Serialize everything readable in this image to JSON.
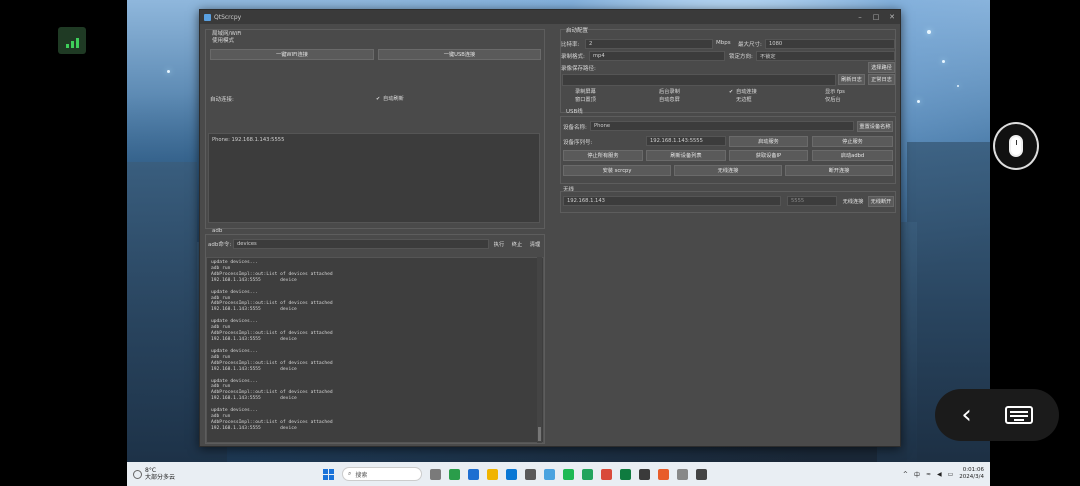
{
  "window": {
    "title": "QtScrcpy"
  },
  "left": {
    "usb_group": "局域网/WiFi",
    "usb_mode": "使用模式",
    "btn_wifi": "一键WIFI连接",
    "btn_usb": "一键USB连接",
    "auto_connect_label": "自动连接:",
    "auto_refresh": "自动刷新",
    "device_list_item": "Phone: 192.168.1.143:5555"
  },
  "adb": {
    "group": "adb",
    "cmd_label": "adb命令:",
    "cmd_value": "devices",
    "run": "执行",
    "stop": "终止",
    "clear": "清理"
  },
  "log_entries": [
    "update devices...\nadb run\nAdbProcessImpl::out:List of devices attached\n192.168.1.143:5555       device",
    "update devices...\nadb run\nAdbProcessImpl::out:List of devices attached\n192.168.1.143:5555       device",
    "update devices...\nadb run\nAdbProcessImpl::out:List of devices attached\n192.168.1.143:5555       device",
    "update devices...\nadb run\nAdbProcessImpl::out:List of devices attached\n192.168.1.143:5555       device",
    "update devices...\nadb run\nAdbProcessImpl::out:List of devices attached\n192.168.1.143:5555       device",
    "update devices...\nadb run\nAdbProcessImpl::out:List of devices attached\n192.168.1.143:5555       device"
  ],
  "config": {
    "group": "启动配置",
    "bitrate_label": "比特率:",
    "bitrate_value": "2",
    "bitrate_unit": "Mbps",
    "max_size_label": "最大尺寸:",
    "max_size_value": "1080",
    "record_format_label": "录制格式:",
    "record_format_value": "mp4",
    "lock_orientation_label": "锁定方向:",
    "lock_orientation_value": "不锁定",
    "record_path_label": "录像保存路径:",
    "select_path": "选择路径",
    "open_log": "刷新日志",
    "stop_record": "正常日志",
    "checks": [
      {
        "label": "录制屏幕",
        "checked": false
      },
      {
        "label": "后台录制",
        "checked": false
      },
      {
        "label": "自动连接",
        "checked": true
      },
      {
        "label": "显示 fps",
        "checked": false
      },
      {
        "label": "窗口置顶",
        "checked": false
      },
      {
        "label": "自动息屏",
        "checked": false
      },
      {
        "label": "无边框",
        "checked": false
      },
      {
        "label": "仅后台",
        "checked": false
      }
    ]
  },
  "usb_line": {
    "group": "USB线"
  },
  "device": {
    "name_label": "设备名称:",
    "name_value": "Phone",
    "rename": "重置设备名称",
    "serial_label": "设备序列号:",
    "serial_value": "192.168.1.143:5555",
    "start_service": "启动服务",
    "stop_service": "停止服务",
    "stop_all": "停止所有服务",
    "refresh": "刷新设备列表",
    "get_ip": "获取设备IP",
    "start_adbd": "启动adbd",
    "install_apk": "安装 scrcpy",
    "wireless": "无线连接",
    "disconnect": "断开连接"
  },
  "wireless": {
    "group": "无线",
    "ip_value": "192.168.1.143",
    "port_value": "5555",
    "connect": "无线连接",
    "disconnect": "无线断开"
  },
  "taskbar": {
    "temp": "8°C",
    "weather": "大部分多云",
    "search": "搜索",
    "time": "0:01:06",
    "date": "2024/3/4"
  }
}
